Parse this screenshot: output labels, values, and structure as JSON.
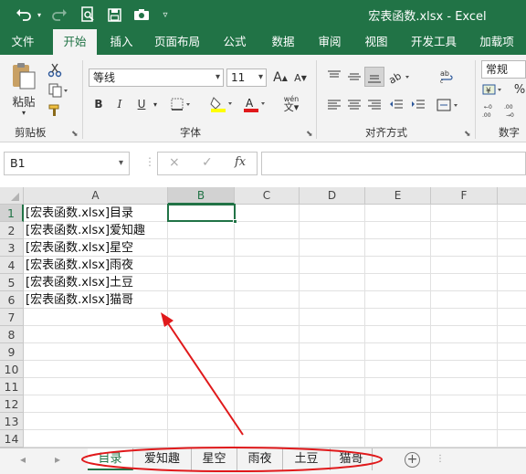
{
  "title_bar": {
    "document_title": "宏表函数.xlsx",
    "separator": " - ",
    "app_name": "Excel",
    "quick_access": [
      "undo-icon",
      "redo-icon",
      "print-preview-icon",
      "save-icon",
      "camera-icon",
      "customize-icon"
    ]
  },
  "ribbon_tabs": [
    {
      "label": "文件"
    },
    {
      "label": "开始"
    },
    {
      "label": "插入"
    },
    {
      "label": "页面布局"
    },
    {
      "label": "公式"
    },
    {
      "label": "数据"
    },
    {
      "label": "审阅"
    },
    {
      "label": "视图"
    },
    {
      "label": "开发工具"
    },
    {
      "label": "加载项"
    }
  ],
  "active_tab": "开始",
  "ribbon": {
    "clipboard": {
      "paste_label": "粘贴",
      "group_label": "剪贴板"
    },
    "font": {
      "font_name": "等线",
      "font_size": "11",
      "bold": "B",
      "italic": "I",
      "underline": "U",
      "group_label": "字体",
      "wen_label": "wén"
    },
    "alignment": {
      "group_label": "对齐方式"
    },
    "number": {
      "format": "常规",
      "percent": "%",
      "group_label": "数字"
    }
  },
  "formula_bar": {
    "name_box": "B1",
    "cancel": "×",
    "enter": "✓",
    "function": "fx",
    "content": ""
  },
  "columns": [
    "A",
    "B",
    "C",
    "D",
    "E",
    "F"
  ],
  "rows": [
    "1",
    "2",
    "3",
    "4",
    "5",
    "6",
    "7",
    "8",
    "9",
    "10",
    "11",
    "12",
    "13",
    "14"
  ],
  "cells_A": [
    "[宏表函数.xlsx]目录",
    "[宏表函数.xlsx]爱知趣",
    "[宏表函数.xlsx]星空",
    "[宏表函数.xlsx]雨夜",
    "[宏表函数.xlsx]土豆",
    "[宏表函数.xlsx]猫哥"
  ],
  "selected_cell": "B1",
  "sheet_tabs": [
    {
      "label": "目录",
      "active": true
    },
    {
      "label": "爱知趣",
      "active": false
    },
    {
      "label": "星空",
      "active": false
    },
    {
      "label": "雨夜",
      "active": false
    },
    {
      "label": "土豆",
      "active": false
    },
    {
      "label": "猫哥",
      "active": false
    }
  ],
  "add_sheet": "+",
  "annotation_color": "#e0191b",
  "accent_color": "#217346"
}
